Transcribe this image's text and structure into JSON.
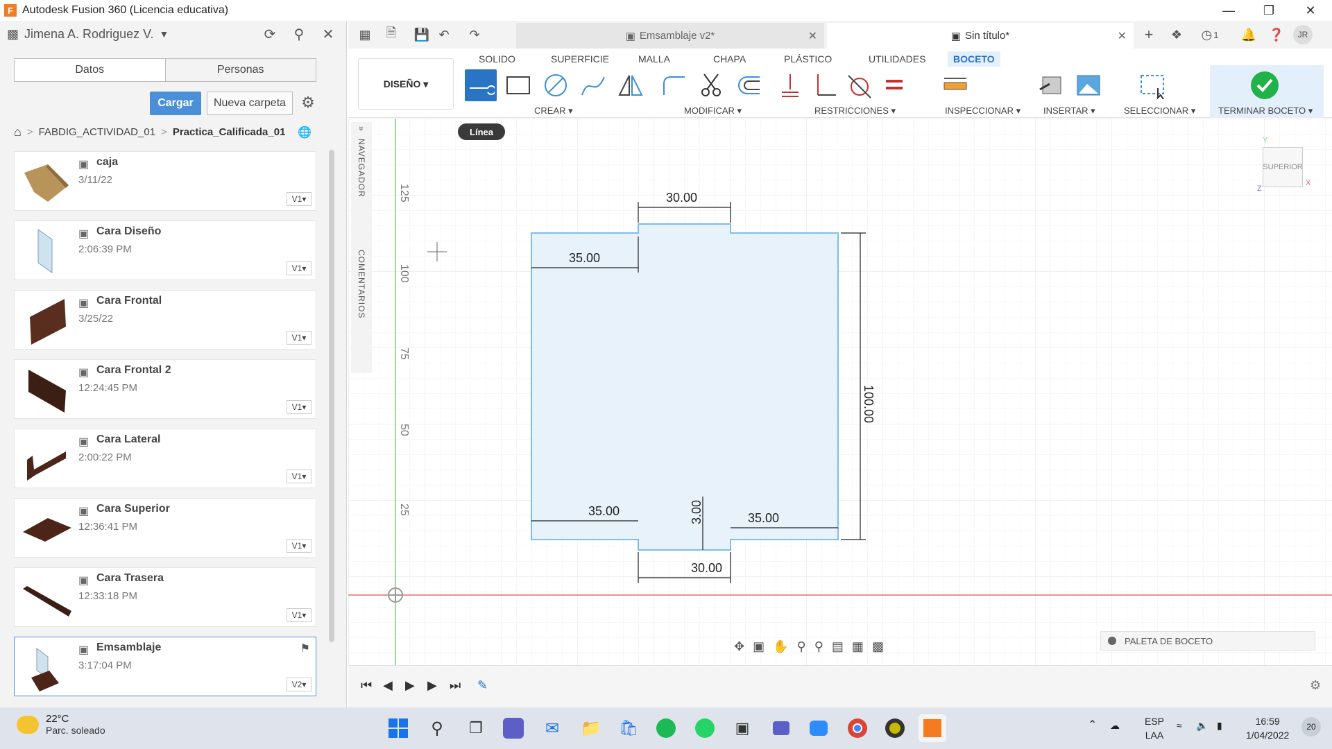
{
  "window": {
    "title": "Autodesk Fusion 360 (Licencia educativa)",
    "logo_letter": "F"
  },
  "datapanel": {
    "user": "Jimena A. Rodriguez V.",
    "tabs": [
      "Datos",
      "Personas"
    ],
    "upload_label": "Cargar",
    "new_folder_label": "Nueva carpeta",
    "breadcrumb": {
      "project": "FABDIG_ACTIVIDAD_01",
      "folder": "Practica_Calificada_01"
    },
    "files": [
      {
        "name": "caja",
        "date": "3/11/22",
        "version": "V1"
      },
      {
        "name": "Cara Diseño",
        "date": "2:06:39 PM",
        "version": "V1"
      },
      {
        "name": "Cara Frontal",
        "date": "3/25/22",
        "version": "V1"
      },
      {
        "name": "Cara Frontal 2",
        "date": "12:24:45 PM",
        "version": "V1"
      },
      {
        "name": "Cara Lateral",
        "date": "2:00:22 PM",
        "version": "V1"
      },
      {
        "name": "Cara Superior",
        "date": "12:36:41 PM",
        "version": "V1"
      },
      {
        "name": "Cara Trasera",
        "date": "12:33:18 PM",
        "version": "V1"
      },
      {
        "name": "Emsamblaje",
        "date": "3:17:04 PM",
        "version": "V2"
      }
    ]
  },
  "doc_tabs": [
    {
      "label": "Emsamblaje v2*",
      "active": false
    },
    {
      "label": "Sin título*",
      "active": true
    }
  ],
  "notifications": {
    "jobs_count": "1",
    "avatar_initials": "JR"
  },
  "ribbon": {
    "workspace": "DISEÑO ▾",
    "tabs": [
      "SOLIDO",
      "SUPERFICIE",
      "MALLA",
      "CHAPA",
      "PLÁSTICO",
      "UTILIDADES",
      "BOCETO"
    ],
    "active_tab": "BOCETO",
    "groups": [
      "CREAR ▾",
      "MODIFICAR ▾",
      "RESTRICCIONES ▾",
      "INSPECCIONAR ▾",
      "INSERTAR ▾",
      "SELECCIONAR ▾",
      "TERMINAR BOCETO ▾"
    ]
  },
  "side_browser": {
    "navigator": "NAVEGADOR",
    "comments": "COMENTARIOS"
  },
  "canvas": {
    "tooltip": "Línea",
    "ruler_labels": [
      "125",
      "100",
      "75",
      "50",
      "25"
    ],
    "dimensions": [
      "30.00",
      "35.00",
      "100.00",
      "35.00",
      "3.00",
      "35.00",
      "30.00"
    ],
    "viewcube_label": "SUPERIOR",
    "axis_labels": [
      "Y",
      "X",
      "Z"
    ],
    "palette_label": "PALETA DE BOCETO"
  },
  "taskbar": {
    "temperature": "22°C",
    "weather": "Parc. soleado",
    "language": "ESP",
    "layout": "LAA",
    "time": "16:59",
    "date": "1/04/2022",
    "notification_count": "20"
  },
  "colors": {
    "accent": "#2a74c5",
    "sketch_fill": "#e8f2fb",
    "sketch_stroke": "#7fbde8",
    "finish_green": "#21b24a",
    "y_axis": "#7bd37b",
    "x_axis": "#e96b6b"
  }
}
